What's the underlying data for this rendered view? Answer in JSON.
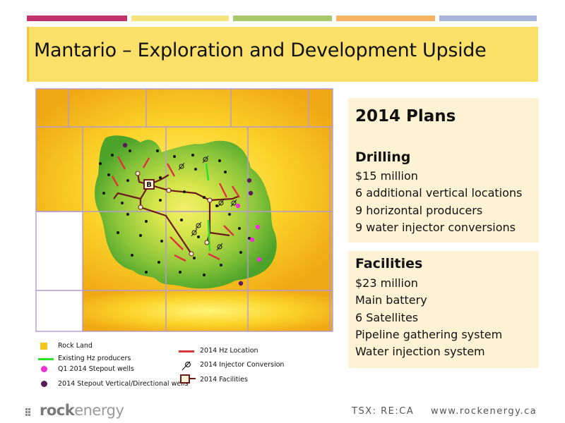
{
  "colors": {
    "bar_1": "#c2336e",
    "bar_2": "#f6e57c",
    "bar_3": "#a8c86a",
    "bar_4": "#f5b364",
    "bar_5": "#a8b4de",
    "title_band": "#fbe06a",
    "panel": "#fdf3d4",
    "rock_land": "#f8c51c",
    "lease_green": "#5fb130",
    "grid_line": "#b49ad0",
    "hz_location": "#e1323c",
    "existing_hz": "#2fe02f",
    "q1_stepout": "#ef2fd6",
    "stepout_vertical": "#5b1a5a",
    "facilities": "#6b1a1a"
  },
  "title": "Mantario – Exploration and Development Upside",
  "plans": {
    "heading": "2014 Plans",
    "drilling": {
      "heading": "Drilling",
      "items": [
        "$15 million",
        "6 additional vertical locations",
        "9 horizontal producers",
        "9 water injector conversions"
      ]
    }
  },
  "facilities": {
    "heading": "Facilities",
    "items": [
      "$23 million",
      "Main battery",
      "6 Satellites",
      "Pipeline gathering system",
      "Water injection system"
    ]
  },
  "map": {
    "facility_label": "B"
  },
  "legend": {
    "rock_land": "Rock Land",
    "existing_hz": "Existing Hz producers",
    "q1_stepout": "Q1 2014 Stepout wells",
    "stepout_vertical": "2014 Stepout Vertical/Directional wells",
    "hz_location": "2014 Hz Location",
    "injector_conversion": "2014 Injector Conversion",
    "facilities": "2014 Facilities"
  },
  "footer": {
    "logo_rock": "rock",
    "logo_energy": "energy",
    "ticker": "TSX: RE:CA",
    "website": "www.rockenergy.ca"
  }
}
